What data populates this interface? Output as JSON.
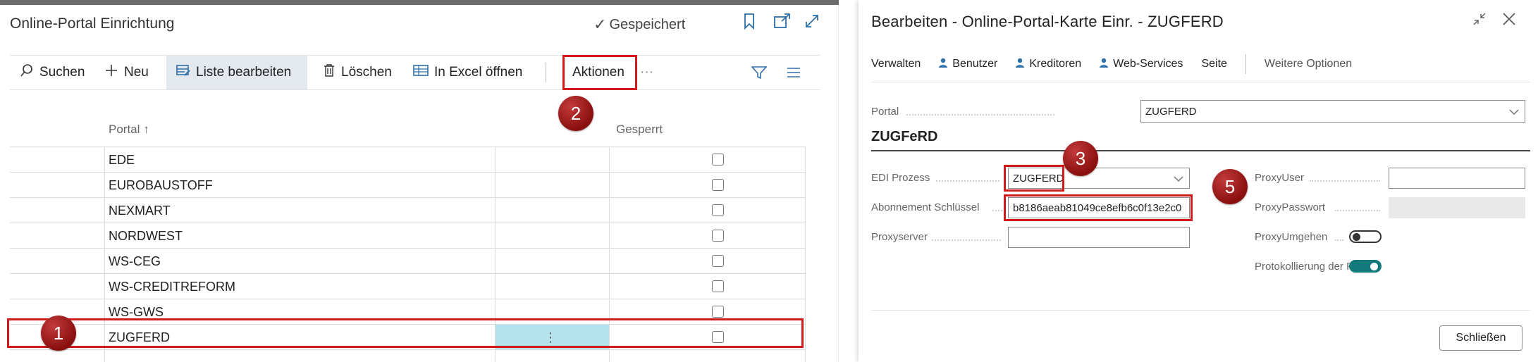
{
  "left": {
    "title": "Online-Portal Einrichtung",
    "saved": "Gespeichert",
    "toolbar": {
      "search": "Suchen",
      "new": "Neu",
      "edit_list": "Liste bearbeiten",
      "delete": "Löschen",
      "excel": "In Excel öffnen",
      "actions": "Aktionen",
      "more": "···"
    },
    "columns": {
      "portal": "Portal ↑",
      "locked": "Gesperrt"
    },
    "rows": [
      {
        "portal": "EDE",
        "locked": false
      },
      {
        "portal": "EUROBAUSTOFF",
        "locked": false
      },
      {
        "portal": "NEXMART",
        "locked": false
      },
      {
        "portal": "NORDWEST",
        "locked": false
      },
      {
        "portal": "WS-CEG",
        "locked": false
      },
      {
        "portal": "WS-CREDITREFORM",
        "locked": false
      },
      {
        "portal": "WS-GWS",
        "locked": false
      },
      {
        "portal": "ZUGFERD",
        "locked": false,
        "selected": true
      }
    ],
    "row_menu": "⋮",
    "markers": {
      "m1": "1",
      "m2": "2"
    }
  },
  "right": {
    "title": "Bearbeiten - Online-Portal-Karte Einr. - ZUGFERD",
    "menu": {
      "manage": "Verwalten",
      "user": "Benutzer",
      "vendors": "Kreditoren",
      "webservices": "Web-Services",
      "page": "Seite",
      "more_options": "Weitere Optionen"
    },
    "portal_label": "Portal",
    "portal_value": "ZUGFERD",
    "section": "ZUGFeRD",
    "fields": {
      "edi_label": "EDI Prozess",
      "edi_value": "ZUGFERD",
      "abo_label": "Abonnement Schlüssel",
      "abo_value": "b8186aeab81049ce8efb6c0f13e2c0",
      "proxyserver_label": "Proxyserver",
      "proxyserver_value": "",
      "proxyuser_label": "ProxyUser",
      "proxyuser_value": "",
      "proxypass_label": "ProxyPasswort",
      "proxybypass_label": "ProxyUmgehen",
      "proxybypass_on": false,
      "logging_label": "Protokollierung der Po...",
      "logging_on": true
    },
    "close": "Schließen",
    "markers": {
      "m3": "3",
      "m5": "5"
    }
  },
  "colors": {
    "accent": "#2f6fa8",
    "highlight": "#d21a1a",
    "selected": "#b4e3ee",
    "toggle_on": "#127a7a"
  },
  "icons": [
    "search-icon",
    "plus-icon",
    "edit-list-icon",
    "trash-icon",
    "excel-icon",
    "filter-icon",
    "list-view-icon",
    "bookmark-icon",
    "share-icon",
    "expand-icon",
    "user-icon",
    "collapse-icon",
    "close-icon",
    "chevron-down-icon",
    "checkmark-icon"
  ]
}
